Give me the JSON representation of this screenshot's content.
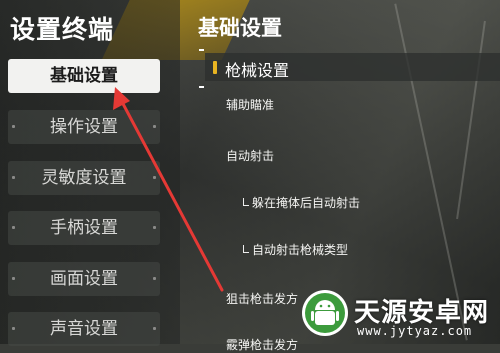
{
  "sidebar": {
    "title": "设置终端",
    "items": [
      {
        "label": "基础设置",
        "active": true
      },
      {
        "label": "操作设置",
        "active": false
      },
      {
        "label": "灵敏度设置",
        "active": false
      },
      {
        "label": "手柄设置",
        "active": false
      },
      {
        "label": "画面设置",
        "active": false
      },
      {
        "label": "声音设置",
        "active": false
      }
    ]
  },
  "main": {
    "section_title": "基础设置",
    "group_label": "枪械设置",
    "settings": [
      {
        "label": "辅助瞄准"
      },
      {
        "label": "自动射击"
      },
      {
        "label": "躲在掩体后自动射击"
      },
      {
        "label": "自动射击枪械类型"
      },
      {
        "label": "狙击枪击发方"
      },
      {
        "label": "霰弹枪击发方"
      }
    ]
  },
  "annotation": {
    "color": "#e53935"
  },
  "watermark": {
    "title": "天源安卓网",
    "url": "www.jytyaz.com",
    "icon": "android-robot-icon"
  },
  "colors": {
    "accent": "#e8b422",
    "active_bg": "#f2f2f0"
  }
}
